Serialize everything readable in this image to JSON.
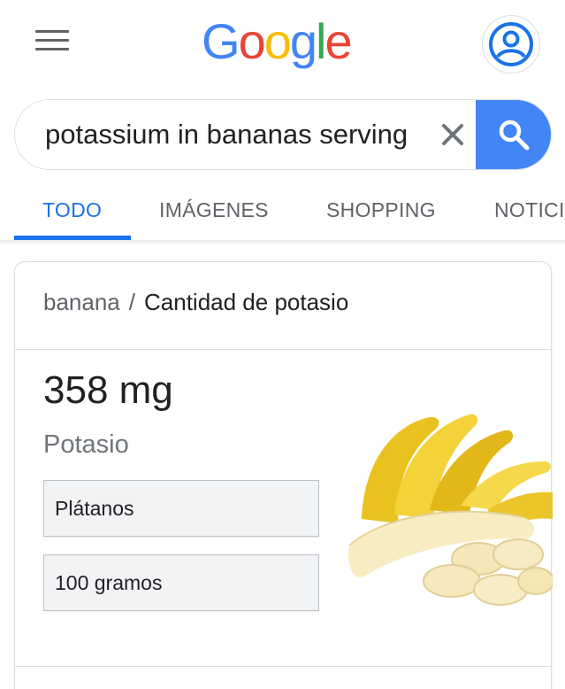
{
  "header": {
    "logo": {
      "letters": [
        "G",
        "o",
        "o",
        "g",
        "l",
        "e"
      ]
    },
    "menu_icon": "hamburger-menu-icon",
    "account_icon": "account-circle-icon"
  },
  "search": {
    "query": "potassium in bananas serving",
    "clear_icon": "close-icon",
    "search_icon": "search-icon",
    "accent_color": "#4285f4"
  },
  "tabs": [
    {
      "label": "TODO",
      "active": true
    },
    {
      "label": "IMÁGENES",
      "active": false
    },
    {
      "label": "SHOPPING",
      "active": false
    },
    {
      "label": "NOTICI",
      "active": false
    }
  ],
  "card": {
    "breadcrumb": {
      "parent": "banana",
      "separator": "/",
      "current": "Cantidad de potasio"
    },
    "value": "358 mg",
    "nutrient": "Potasio",
    "food_select": "Plátanos",
    "amount_select": "100 gramos",
    "image": "banana-image"
  }
}
